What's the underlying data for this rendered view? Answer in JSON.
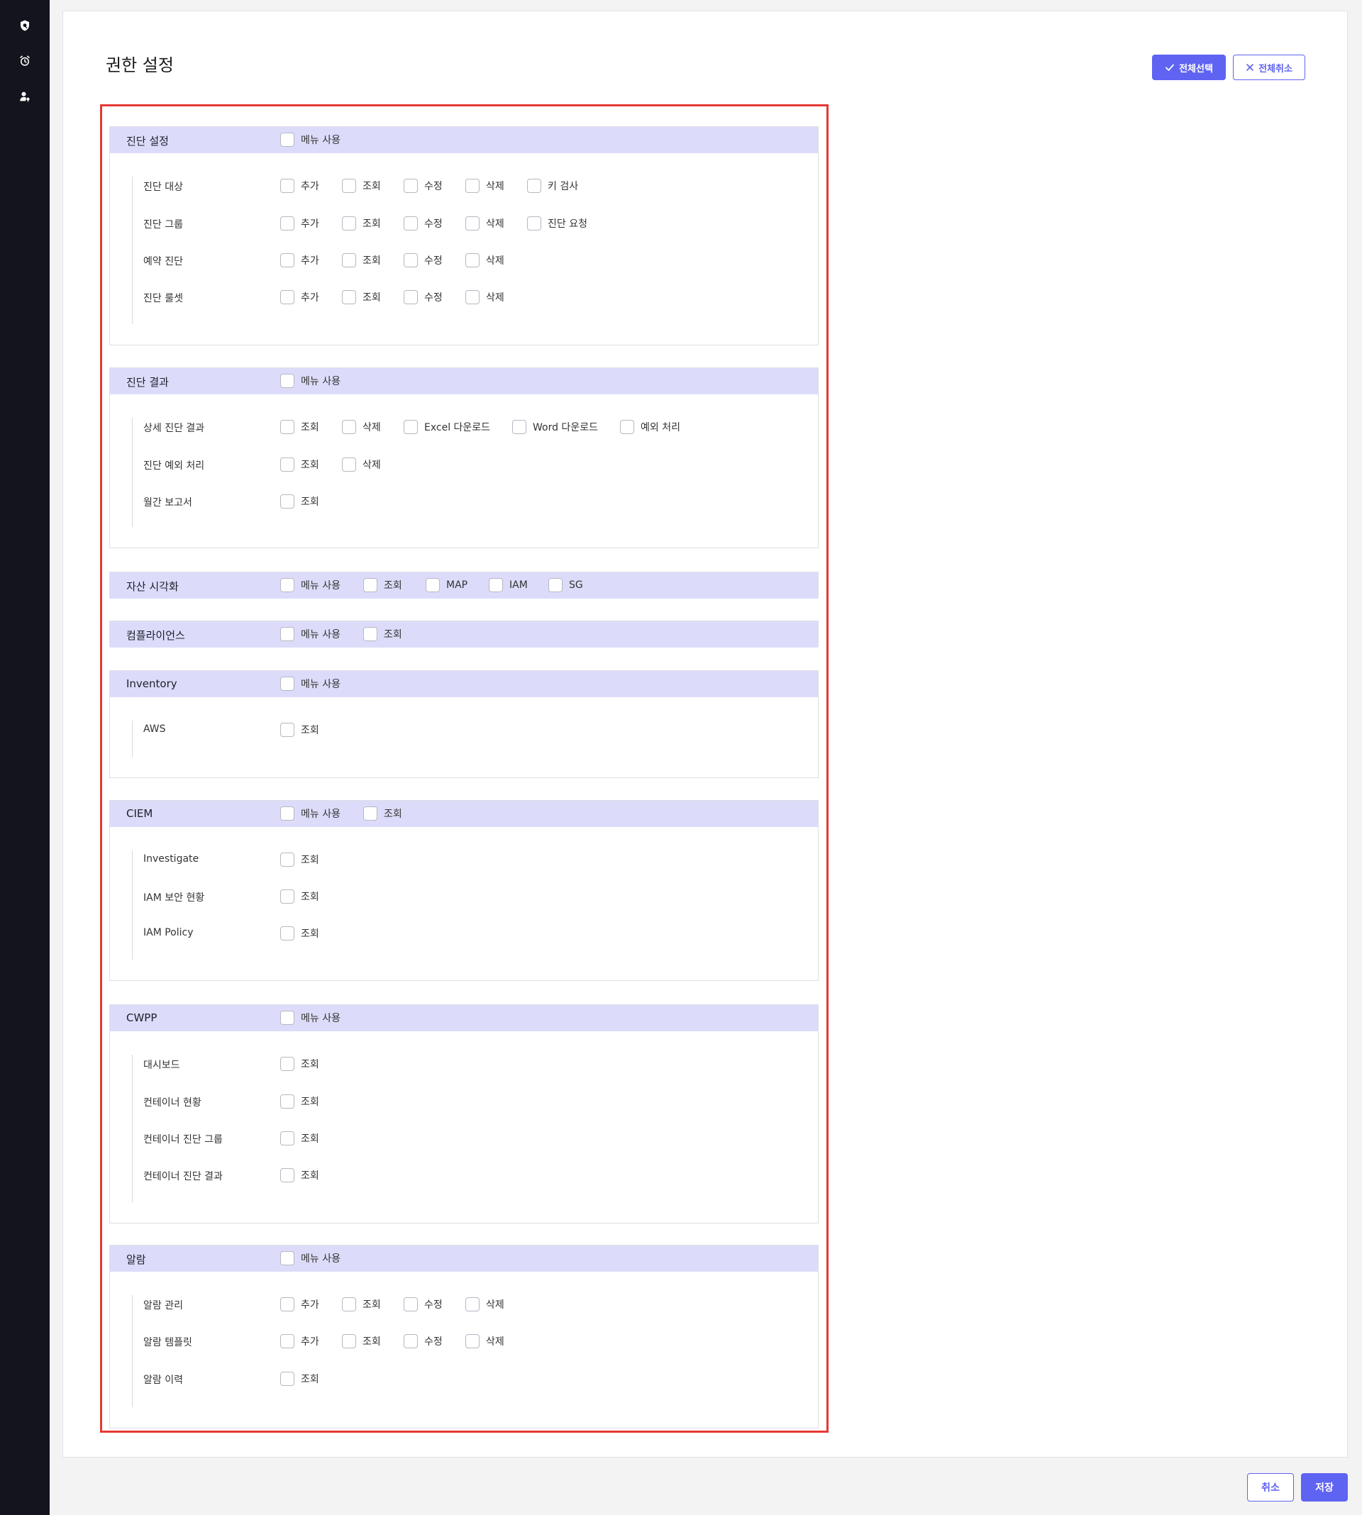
{
  "page_title": "권한 설정",
  "buttons": {
    "select_all": "전체선택",
    "clear_all": "전체취소",
    "cancel": "취소",
    "save": "저장"
  },
  "sections": [
    {
      "title": "진단 설정",
      "head_options": [
        "메뉴 사용"
      ],
      "rows": [
        {
          "label": "진단 대상",
          "options": [
            "추가",
            "조회",
            "수정",
            "삭제",
            "키 검사"
          ]
        },
        {
          "label": "진단 그룹",
          "options": [
            "추가",
            "조회",
            "수정",
            "삭제",
            "진단 요청"
          ]
        },
        {
          "label": "예약 진단",
          "options": [
            "추가",
            "조회",
            "수정",
            "삭제"
          ]
        },
        {
          "label": "진단 룰셋",
          "options": [
            "추가",
            "조회",
            "수정",
            "삭제"
          ]
        }
      ]
    },
    {
      "title": "진단 결과",
      "head_options": [
        "메뉴 사용"
      ],
      "rows": [
        {
          "label": "상세 진단 결과",
          "options": [
            "조회",
            "삭제",
            "Excel 다운로드",
            "Word 다운로드",
            "예외 처리"
          ]
        },
        {
          "label": "진단 예외 처리",
          "options": [
            "조회",
            "삭제"
          ]
        },
        {
          "label": "월간 보고서",
          "options": [
            "조회"
          ]
        }
      ]
    },
    {
      "title": "자산 시각화",
      "head_options": [
        "메뉴 사용",
        "조회",
        "MAP",
        "IAM",
        "SG"
      ],
      "rows": []
    },
    {
      "title": "컴플라이언스",
      "head_options": [
        "메뉴 사용",
        "조회"
      ],
      "rows": []
    },
    {
      "title": "Inventory",
      "head_options": [
        "메뉴 사용"
      ],
      "rows": [
        {
          "label": "AWS",
          "options": [
            "조회"
          ]
        }
      ]
    },
    {
      "title": "CIEM",
      "head_options": [
        "메뉴 사용",
        "조회"
      ],
      "rows": [
        {
          "label": "Investigate",
          "options": [
            "조회"
          ]
        },
        {
          "label": "IAM 보안 현황",
          "options": [
            "조회"
          ]
        },
        {
          "label": "IAM Policy",
          "options": [
            "조회"
          ]
        }
      ]
    },
    {
      "title": "CWPP",
      "head_options": [
        "메뉴 사용"
      ],
      "rows": [
        {
          "label": "대시보드",
          "options": [
            "조회"
          ]
        },
        {
          "label": "컨테이너 현황",
          "options": [
            "조회"
          ]
        },
        {
          "label": "컨테이너 진단 그룹",
          "options": [
            "조회"
          ]
        },
        {
          "label": "컨테이너 진단 결과",
          "options": [
            "조회"
          ]
        }
      ]
    },
    {
      "title": "알람",
      "head_options": [
        "메뉴 사용"
      ],
      "rows": [
        {
          "label": "알람 관리",
          "options": [
            "추가",
            "조회",
            "수정",
            "삭제"
          ]
        },
        {
          "label": "알람 템플릿",
          "options": [
            "추가",
            "조회",
            "수정",
            "삭제"
          ]
        },
        {
          "label": "알람 이력",
          "options": [
            "조회"
          ]
        }
      ]
    }
  ],
  "colors": {
    "accent": "#5f63f2",
    "section_header": "#dcdcfa",
    "sidebar": "#14141f",
    "highlight_frame": "#e53935"
  },
  "icons": [
    "shield-icon",
    "alarm-clock-icon",
    "user-key-icon",
    "check-icon",
    "close-icon"
  ]
}
